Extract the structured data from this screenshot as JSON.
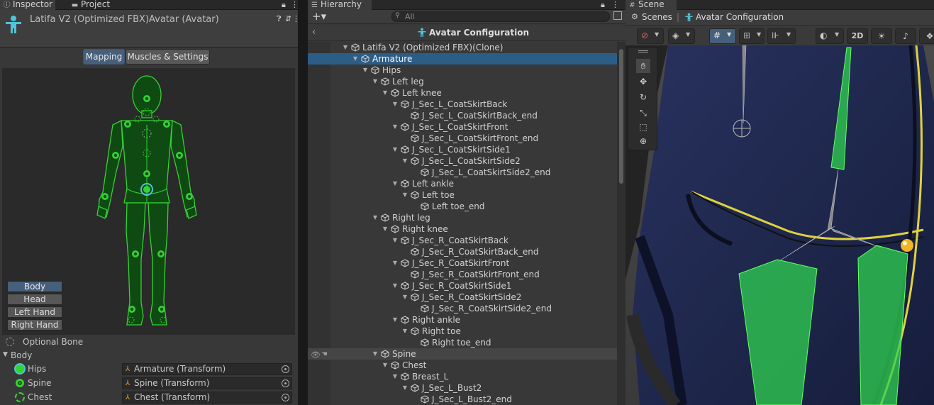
{
  "colors": {
    "panel": "#383838",
    "tabbar": "#282828",
    "selection": "#2c5d87",
    "accent_green": "#35d135",
    "scene_coat": "#1f2850",
    "coat_trim": "#e0d33b"
  },
  "inspector": {
    "tab_inspector": "Inspector",
    "tab_project": "Project",
    "title": "Latifa V2 (Optimized FBX)Avatar (Avatar)",
    "mode_buttons": [
      {
        "label": "Mapping",
        "selected": true
      },
      {
        "label": "Muscles & Settings",
        "selected": false
      }
    ],
    "body_parts": [
      {
        "label": "Body",
        "selected": true
      },
      {
        "label": "Head",
        "selected": false
      },
      {
        "label": "Left Hand",
        "selected": false
      },
      {
        "label": "Right Hand",
        "selected": false
      }
    ],
    "optional_bone": "Optional Bone",
    "section": "Body",
    "bones": [
      {
        "name": "Hips",
        "value": "Armature (Transform)"
      },
      {
        "name": "Spine",
        "value": "Spine (Transform)"
      },
      {
        "name": "Chest",
        "value": "Chest (Transform)"
      }
    ]
  },
  "hierarchy": {
    "tab": "Hierarchy",
    "search_placeholder": "All",
    "breadcrumb": "Avatar Configuration",
    "rows": [
      {
        "label": "Latifa V2 (Optimized FBX)(Clone)",
        "depth": 0,
        "expanded": true
      },
      {
        "label": "Armature",
        "depth": 1,
        "expanded": true,
        "selected": true
      },
      {
        "label": "Hips",
        "depth": 2,
        "expanded": true
      },
      {
        "label": "Left leg",
        "depth": 3,
        "expanded": true
      },
      {
        "label": "Left knee",
        "depth": 4,
        "expanded": true
      },
      {
        "label": "J_Sec_L_CoatSkirtBack",
        "depth": 5,
        "expanded": true
      },
      {
        "label": "J_Sec_L_CoatSkirtBack_end",
        "depth": 6
      },
      {
        "label": "J_Sec_L_CoatSkirtFront",
        "depth": 5,
        "expanded": true
      },
      {
        "label": "J_Sec_L_CoatSkirtFront_end",
        "depth": 6
      },
      {
        "label": "J_Sec_L_CoatSkirtSide1",
        "depth": 5,
        "expanded": true
      },
      {
        "label": "J_Sec_L_CoatSkirtSide2",
        "depth": 6,
        "expanded": true
      },
      {
        "label": "J_Sec_L_CoatSkirtSide2_end",
        "depth": 7
      },
      {
        "label": "Left ankle",
        "depth": 5,
        "expanded": true
      },
      {
        "label": "Left toe",
        "depth": 6,
        "expanded": true
      },
      {
        "label": "Left toe_end",
        "depth": 7
      },
      {
        "label": "Right leg",
        "depth": 3,
        "expanded": true
      },
      {
        "label": "Right knee",
        "depth": 4,
        "expanded": true
      },
      {
        "label": "J_Sec_R_CoatSkirtBack",
        "depth": 5,
        "expanded": true
      },
      {
        "label": "J_Sec_R_CoatSkirtBack_end",
        "depth": 6
      },
      {
        "label": "J_Sec_R_CoatSkirtFront",
        "depth": 5,
        "expanded": true
      },
      {
        "label": "J_Sec_R_CoatSkirtFront_end",
        "depth": 6
      },
      {
        "label": "J_Sec_R_CoatSkirtSide1",
        "depth": 5,
        "expanded": true
      },
      {
        "label": "J_Sec_R_CoatSkirtSide2",
        "depth": 6,
        "expanded": true
      },
      {
        "label": "J_Sec_R_CoatSkirtSide2_end",
        "depth": 7
      },
      {
        "label": "Right ankle",
        "depth": 5,
        "expanded": true
      },
      {
        "label": "Right toe",
        "depth": 6,
        "expanded": true
      },
      {
        "label": "Right toe_end",
        "depth": 7
      },
      {
        "label": "Spine",
        "depth": 3,
        "expanded": true,
        "hovered": true
      },
      {
        "label": "Chest",
        "depth": 4,
        "expanded": true
      },
      {
        "label": "Breast_L",
        "depth": 5,
        "expanded": true
      },
      {
        "label": "J_Sec_L_Bust2",
        "depth": 6,
        "expanded": true
      },
      {
        "label": "J_Sec_L_Bust2_end",
        "depth": 7
      }
    ]
  },
  "scene": {
    "tab": "Scene",
    "breadcrumb_root": "Scenes",
    "breadcrumb_current": "Avatar Configuration",
    "btn_2d": "2D",
    "tools": [
      "hand-tool",
      "move-tool",
      "rotate-tool",
      "scale-tool",
      "rect-tool",
      "transform-tool"
    ]
  }
}
